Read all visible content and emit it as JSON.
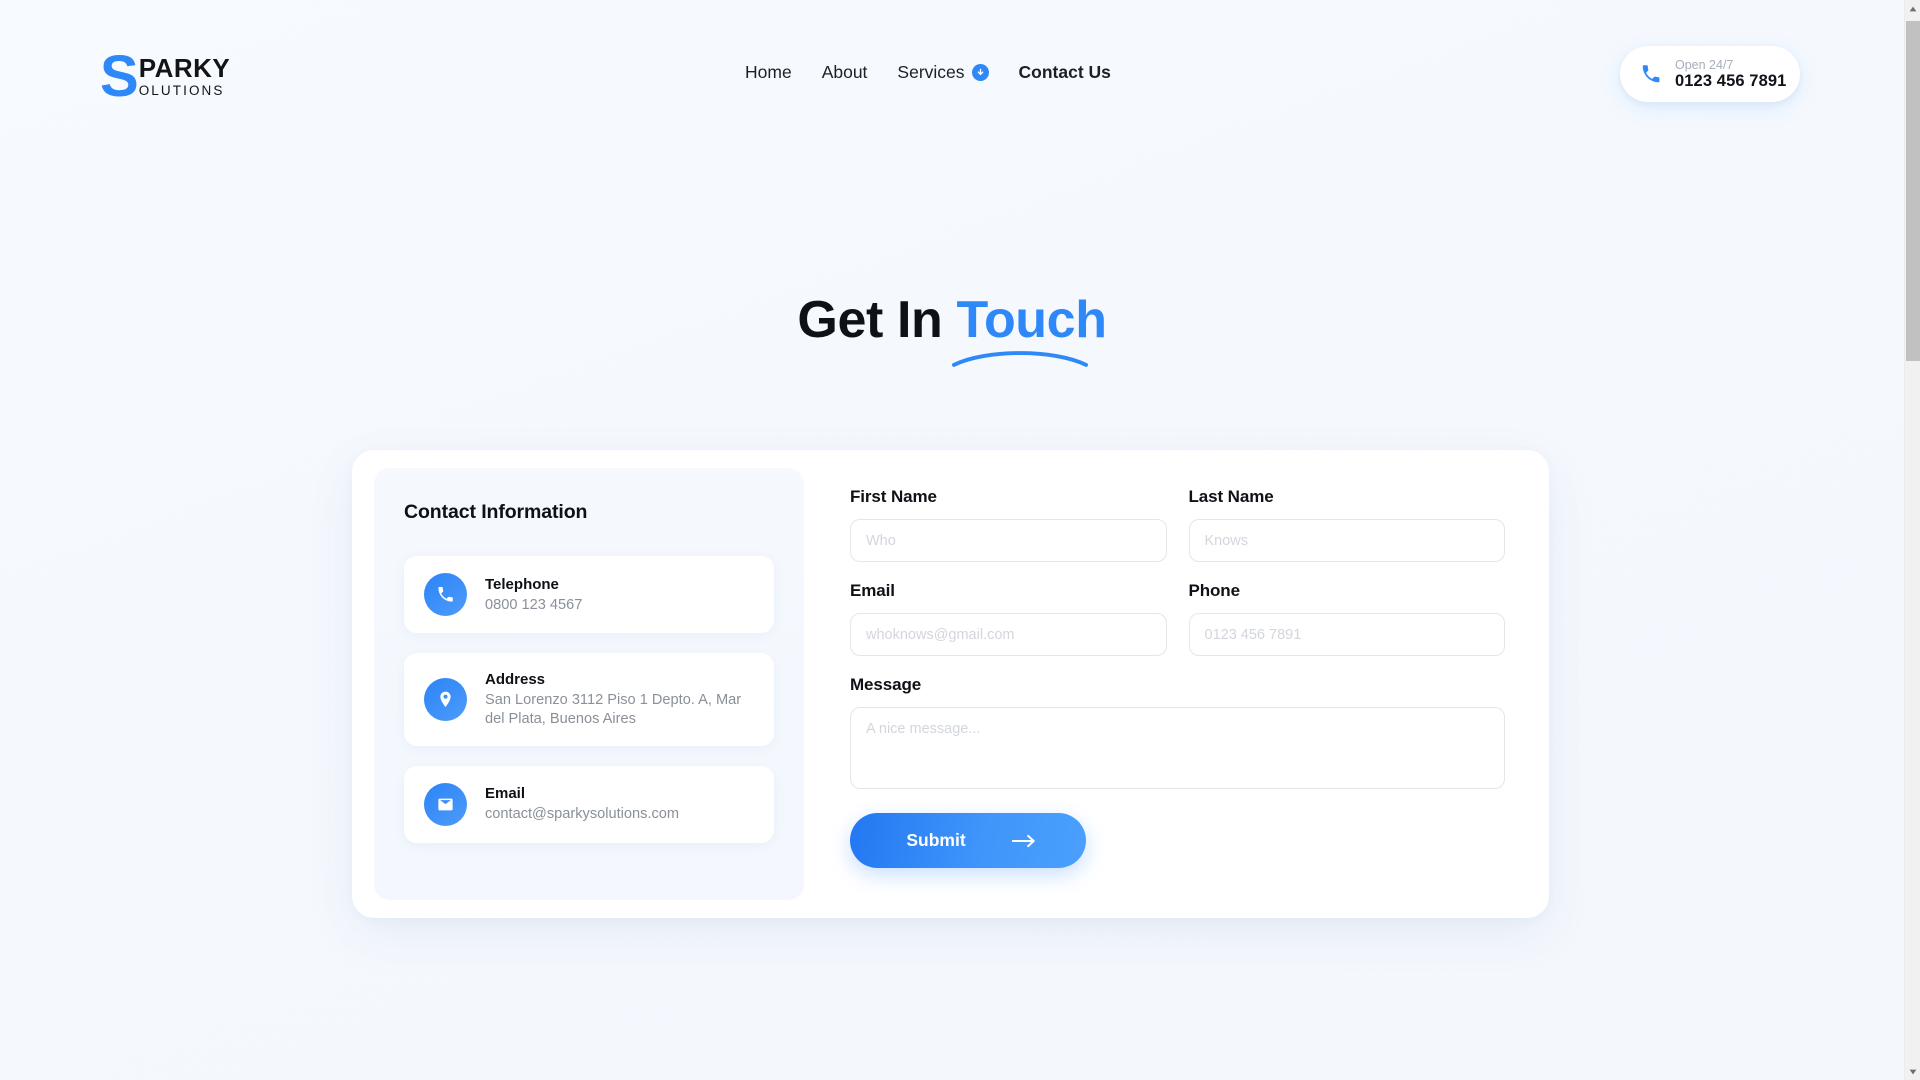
{
  "header": {
    "logo": {
      "mark": "S",
      "top": "PARKY",
      "bottom": "OLUTIONS"
    },
    "nav": [
      {
        "label": "Home",
        "active": false,
        "has_caret": false
      },
      {
        "label": "About",
        "active": false,
        "has_caret": false
      },
      {
        "label": "Services",
        "active": false,
        "has_caret": true
      },
      {
        "label": "Contact Us",
        "active": true,
        "has_caret": false
      }
    ],
    "phone_pill": {
      "label": "Open 24/7",
      "number": "0123 456 7891",
      "icon": "phone-icon"
    }
  },
  "title": {
    "plain": "Get In",
    "accent": "Touch"
  },
  "contact_info": {
    "heading": "Contact Information",
    "items": [
      {
        "icon": "phone-icon",
        "label": "Telephone",
        "value": "0800 123 4567"
      },
      {
        "icon": "map-pin-icon",
        "label": "Address",
        "value": "San Lorenzo 3112 Piso 1 Depto. A, Mar del Plata, Buenos Aires"
      },
      {
        "icon": "envelope-icon",
        "label": "Email",
        "value": "contact@sparkysolutions.com"
      }
    ]
  },
  "form": {
    "first_name": {
      "label": "First Name",
      "placeholder": "Who",
      "value": ""
    },
    "last_name": {
      "label": "Last Name",
      "placeholder": "Knows",
      "value": ""
    },
    "email": {
      "label": "Email",
      "placeholder": "whoknows@gmail.com",
      "value": ""
    },
    "phone": {
      "label": "Phone",
      "placeholder": "0123 456 7891",
      "value": ""
    },
    "message": {
      "label": "Message",
      "placeholder": "A nice message...",
      "value": ""
    },
    "submit_label": "Submit"
  },
  "colors": {
    "accent": "#2f88f7",
    "accent_dark": "#2377f2",
    "text": "#0e1116",
    "muted": "#8a9099",
    "page_bg": "#f6f9fe",
    "placeholder": "#d2d6dc"
  }
}
